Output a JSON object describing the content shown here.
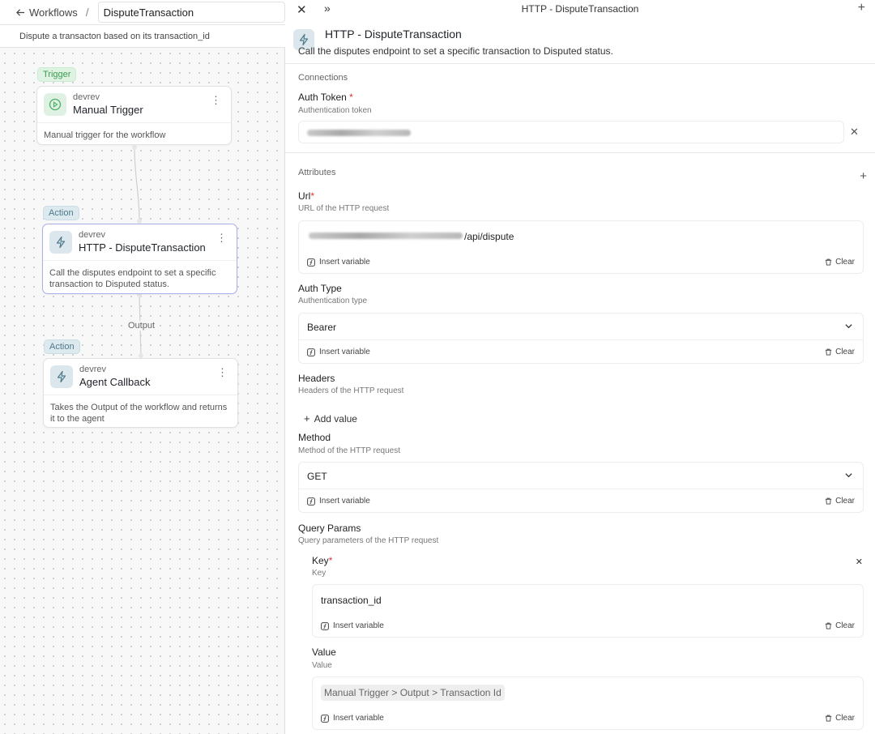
{
  "left": {
    "back_label": "Workflows",
    "separator": "/",
    "workflow_name": "DisputeTransaction",
    "workflow_description": "Dispute a transacton based on its transaction_id",
    "nodes": [
      {
        "badge": "Trigger",
        "vendor": "devrev",
        "title": "Manual Trigger",
        "description": "Manual trigger for the workflow"
      },
      {
        "badge": "Action",
        "vendor": "devrev",
        "title": "HTTP - DisputeTransaction",
        "description": "Call the disputes endpoint to set a specific transaction to Disputed status."
      },
      {
        "badge": "Action",
        "vendor": "devrev",
        "title": "Agent Callback",
        "description": "Takes the Output of the workflow and returns it to the agent"
      }
    ],
    "edge_label": "Output"
  },
  "panel": {
    "top_title": "HTTP - DisputeTransaction",
    "title": "HTTP - DisputeTransaction",
    "description": "Call the disputes endpoint to set a specific transaction to Disputed status.",
    "connections_label": "Connections",
    "auth_token": {
      "label": "Auth Token",
      "required": "*",
      "sub": "Authentication token"
    },
    "attributes_label": "Attributes",
    "url": {
      "label": "Url",
      "required": "*",
      "sub": "URL of the HTTP request",
      "value_suffix": "/api/dispute"
    },
    "auth_type": {
      "label": "Auth Type",
      "sub": "Authentication type",
      "value": "Bearer"
    },
    "headers": {
      "label": "Headers",
      "sub": "Headers of the HTTP request",
      "add_label": "Add value"
    },
    "method": {
      "label": "Method",
      "sub": "Method of the HTTP request",
      "value": "GET"
    },
    "query_params": {
      "label": "Query Params",
      "sub": "Query parameters of the HTTP request"
    },
    "key": {
      "label": "Key",
      "required": "*",
      "sub": "Key",
      "value": "transaction_id"
    },
    "value": {
      "label": "Value",
      "sub": "Value",
      "value": "Manual Trigger > Output > Transaction Id"
    },
    "insert_variable": "Insert variable",
    "clear": "Clear"
  }
}
